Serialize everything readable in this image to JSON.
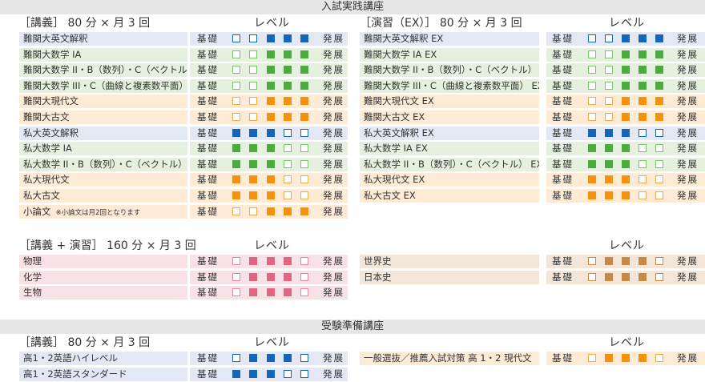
{
  "colors": {
    "blue": {
      "bg": "#e3e8f4",
      "fill": "#1565b8",
      "stroke": "#1565b8"
    },
    "green": {
      "bg": "#e5f1de",
      "fill": "#4aac3c",
      "stroke": "#7cc36d"
    },
    "orange": {
      "bg": "#fdebd6",
      "fill": "#f4920e",
      "stroke": "#f4a94a"
    },
    "pink": {
      "bg": "#f9e2e6",
      "fill": "#e06682",
      "stroke": "#e888a0"
    },
    "tan": {
      "bg": "#f3e6d8",
      "fill": "#c78a46",
      "stroke": "#c78a46"
    }
  },
  "section1": {
    "title": "入試実践講座",
    "left": {
      "header": "［講義］ 80 分 × 月 3 回",
      "level": "レベル"
    },
    "right": {
      "header": "［演習（EX）］ 80 分 × 月 3 回",
      "level": "レベル"
    }
  },
  "section2": {
    "left": {
      "header": "［講義 + 演習］ 160 分 × 月 3 回",
      "level": "レベル"
    },
    "right": {
      "level": "レベル"
    }
  },
  "section3": {
    "title": "受験準備講座",
    "left": {
      "header": "［講義］ 80 分 × 月 3 回",
      "level": "レベル"
    },
    "right": {
      "level": "レベル"
    }
  },
  "scale_labels": {
    "low": "基礎",
    "high": "発展"
  },
  "courses": {
    "s1_left": [
      {
        "name": "難関大英文解釈",
        "color": "blue",
        "levels": [
          0,
          0,
          1,
          1,
          1
        ]
      },
      {
        "name": "難関大数学 IA",
        "color": "green",
        "levels": [
          0,
          0,
          1,
          1,
          1
        ]
      },
      {
        "name": "難関大数学 II・B（数列）・C（ベクトル）",
        "color": "green",
        "levels": [
          0,
          0,
          1,
          1,
          1
        ]
      },
      {
        "name": "難関大数学 III・C（曲線と複素数平面）",
        "color": "green",
        "levels": [
          0,
          0,
          1,
          1,
          1
        ]
      },
      {
        "name": "難関大現代文",
        "color": "orange",
        "levels": [
          0,
          0,
          1,
          1,
          1
        ]
      },
      {
        "name": "難関大古文",
        "color": "orange",
        "levels": [
          0,
          0,
          1,
          1,
          1
        ]
      },
      {
        "name": "私大英文解釈",
        "color": "blue",
        "levels": [
          1,
          1,
          1,
          0,
          0
        ]
      },
      {
        "name": "私大数学 IA",
        "color": "green",
        "levels": [
          1,
          1,
          1,
          0,
          0
        ]
      },
      {
        "name": "私大数学 II・B（数列）・C（ベクトル）",
        "color": "green",
        "levels": [
          1,
          1,
          1,
          0,
          0
        ]
      },
      {
        "name": "私大現代文",
        "color": "orange",
        "levels": [
          1,
          1,
          1,
          0,
          0
        ]
      },
      {
        "name": "私大古文",
        "color": "orange",
        "levels": [
          1,
          1,
          1,
          0,
          0
        ]
      },
      {
        "name": "小論文",
        "note": "※小論文は月2回となります",
        "color": "orange",
        "levels": [
          0,
          0,
          1,
          1,
          1
        ]
      }
    ],
    "s1_right": [
      {
        "name": "難関大英文解釈 EX",
        "color": "blue",
        "levels": [
          0,
          0,
          1,
          1,
          1
        ]
      },
      {
        "name": "難関大数学 IA EX",
        "color": "green",
        "levels": [
          0,
          0,
          1,
          1,
          1
        ]
      },
      {
        "name": "難関大数学 II・B（数列）・C（ベクトル） EX",
        "color": "green",
        "levels": [
          0,
          0,
          1,
          1,
          1
        ]
      },
      {
        "name": "難関大数学 III・C（曲線と複素数平面） EX",
        "color": "green",
        "levels": [
          0,
          0,
          1,
          1,
          1
        ]
      },
      {
        "name": "難関大現代文 EX",
        "color": "orange",
        "levels": [
          0,
          0,
          1,
          1,
          1
        ]
      },
      {
        "name": "難関大古文 EX",
        "color": "orange",
        "levels": [
          0,
          0,
          1,
          1,
          1
        ]
      },
      {
        "name": "私大英文解釈 EX",
        "color": "blue",
        "levels": [
          1,
          1,
          1,
          0,
          0
        ]
      },
      {
        "name": "私大数学 IA EX",
        "color": "green",
        "levels": [
          1,
          1,
          1,
          0,
          0
        ]
      },
      {
        "name": "私大数学 II・B（数列）・C（ベクトル） EX",
        "color": "green",
        "levels": [
          1,
          1,
          1,
          0,
          0
        ]
      },
      {
        "name": "私大現代文 EX",
        "color": "orange",
        "levels": [
          1,
          1,
          1,
          0,
          0
        ]
      },
      {
        "name": "私大古文 EX",
        "color": "orange",
        "levels": [
          1,
          1,
          1,
          0,
          0
        ]
      }
    ],
    "s2_left": [
      {
        "name": "物理",
        "color": "pink",
        "levels": [
          0,
          1,
          1,
          1,
          0
        ]
      },
      {
        "name": "化学",
        "color": "pink",
        "levels": [
          0,
          1,
          1,
          1,
          0
        ]
      },
      {
        "name": "生物",
        "color": "pink",
        "levels": [
          0,
          1,
          1,
          1,
          0
        ]
      }
    ],
    "s2_right": [
      {
        "name": "世界史",
        "color": "tan",
        "levels": [
          0,
          1,
          1,
          1,
          0
        ]
      },
      {
        "name": "日本史",
        "color": "tan",
        "levels": [
          0,
          1,
          1,
          1,
          0
        ]
      }
    ],
    "s3_left": [
      {
        "name": "高1・2英語ハイレベル",
        "color": "blue",
        "levels": [
          0,
          1,
          1,
          1,
          0
        ]
      },
      {
        "name": "高1・2英語スタンダード",
        "color": "blue",
        "levels": [
          1,
          1,
          1,
          0,
          0
        ]
      }
    ],
    "s3_right": [
      {
        "name": "一般選抜／推薦入試対策 高 1・2 現代文",
        "color": "orange",
        "levels": [
          0,
          1,
          1,
          1,
          0
        ]
      }
    ]
  }
}
